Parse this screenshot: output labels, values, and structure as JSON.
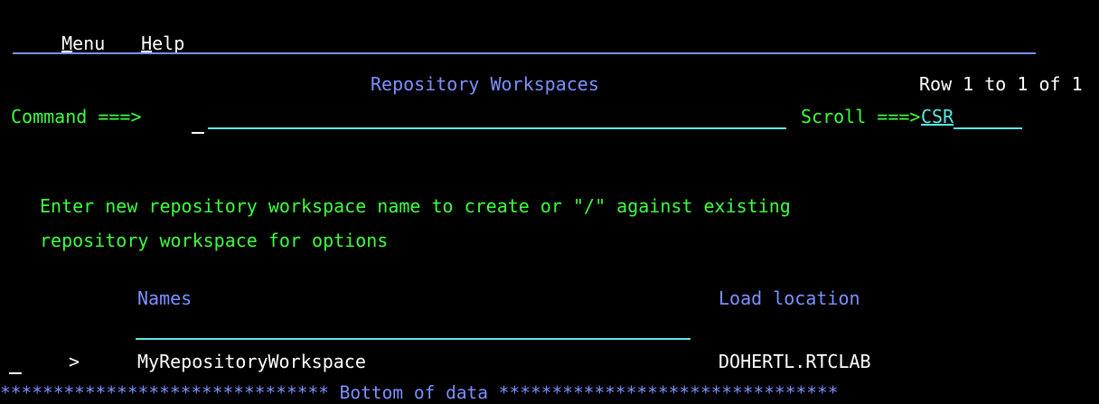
{
  "menubar": {
    "menu_first": "M",
    "menu_rest": "enu",
    "help_first": "H",
    "help_rest": "elp"
  },
  "panel": {
    "title": "Repository Workspaces",
    "row_info": "Row 1 to 1 of 1"
  },
  "command": {
    "label": "Command ===>",
    "value": "",
    "scroll_label": "Scroll ===>",
    "scroll_value": "CSR"
  },
  "instructions": {
    "line1": "Enter new repository workspace name to create or \"/\" against existing",
    "line2": "repository workspace for options"
  },
  "columns": {
    "names": "Names",
    "load_location": "Load location"
  },
  "rows": [
    {
      "marker": ">",
      "name": "MyRepositoryWorkspace",
      "load_location": "DOHERTL.RTCLAB"
    }
  ],
  "footer": {
    "bottom_text": "******************************* Bottom of data ********************************"
  },
  "colors": {
    "background": "#000000",
    "menu_text": "#ffffff",
    "header_blue": "#7d90ff",
    "prompt_green": "#3dff3d",
    "input_cyan": "#5fe6e6"
  }
}
